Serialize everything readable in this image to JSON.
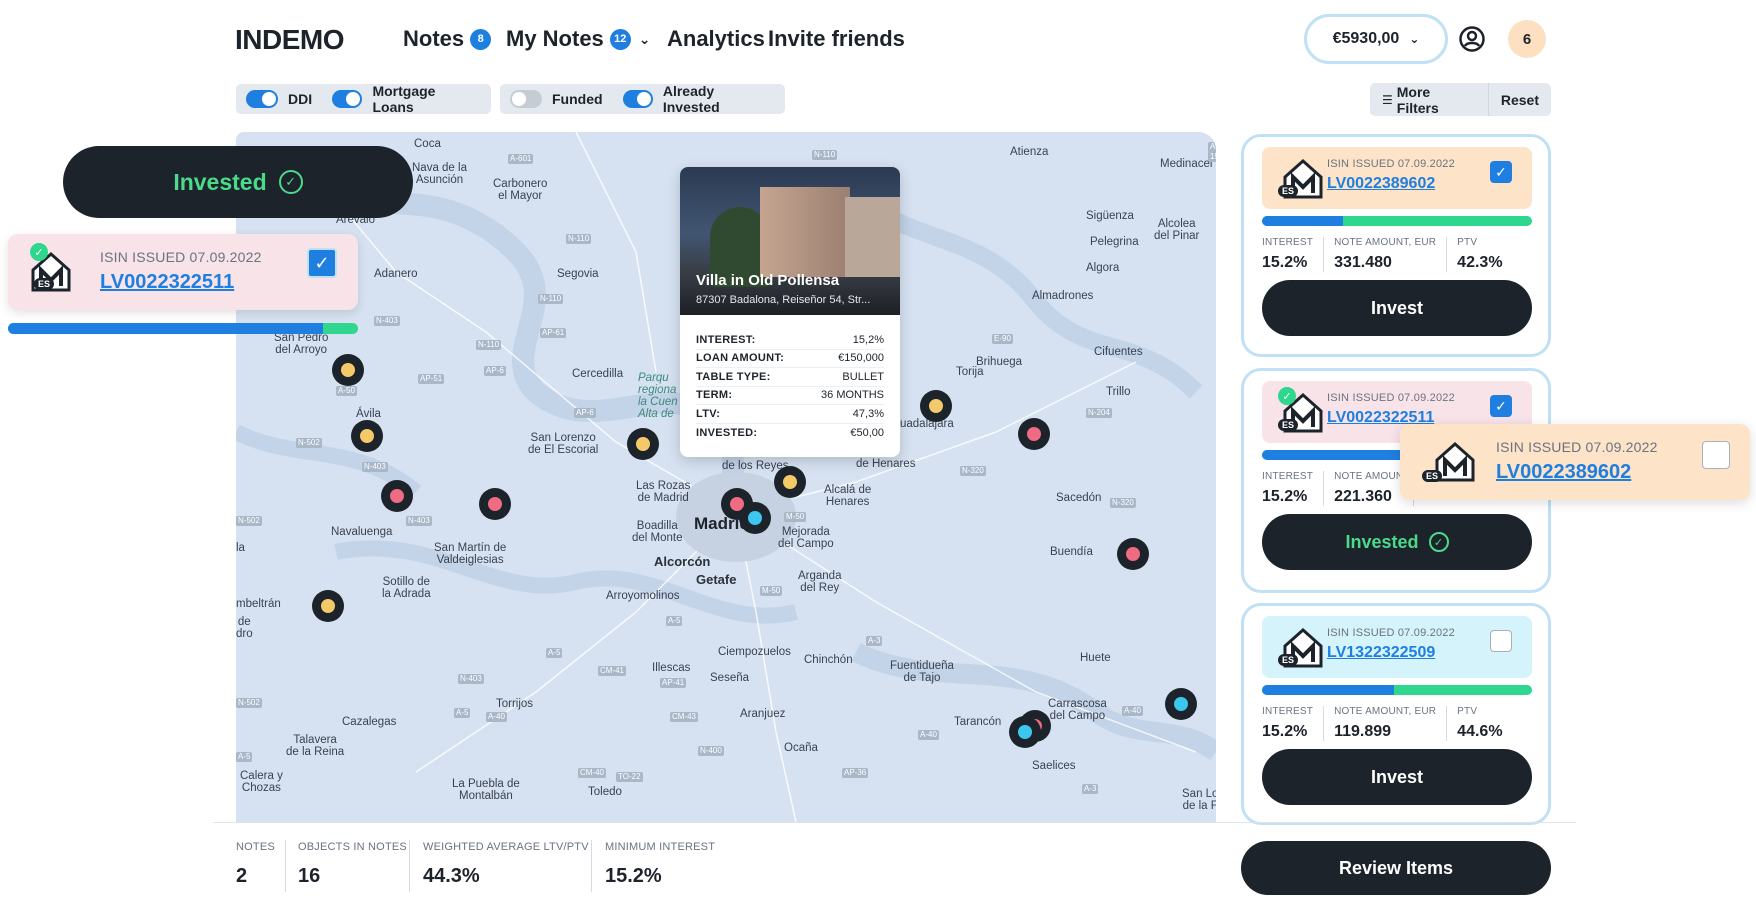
{
  "header": {
    "logo": "INDEMO",
    "nav": [
      {
        "label": "Notes",
        "badge": "8"
      },
      {
        "label": "My Notes",
        "badge": "12"
      },
      {
        "label": "Analytics"
      },
      {
        "label": "Invite friends"
      }
    ],
    "balance": "€5930,00",
    "notifications": "6"
  },
  "filters": {
    "toggles": [
      {
        "label": "DDI",
        "on": true
      },
      {
        "label": "Mortgage Loans",
        "on": true
      },
      {
        "label": "Funded",
        "on": false
      },
      {
        "label": "Already Invested",
        "on": true
      }
    ],
    "more_filters": "More Filters",
    "reset": "Reset"
  },
  "map": {
    "labels": {
      "madrid": "Madrid",
      "getafe": "Getafe",
      "alcorcon": "Alcorcón",
      "coca": "Coca",
      "nava": "Nava de la\nAsunción",
      "carbonero": "Carbonero\nel Mayor",
      "segovia": "Segovia",
      "adanero": "Adanero",
      "arevalo": "Arevalo",
      "sanpedro": "San Pedro\ndel Arroyo",
      "avila": "Ávila",
      "navaluenga": "Navaluenga",
      "cercedilla": "Cercedilla",
      "sanlorenzo": "San Lorenzo\nde El Escorial",
      "lasrozas": "Las Rozas\nde Madrid",
      "boadilla": "Boadilla\ndel Monte",
      "sanmartin": "San Martín de\nValdeiglesias",
      "sotillo": "Sotillo de\nla Adrada",
      "arroyomolinos": "Arroyomolinos",
      "ciempozuelos": "Ciempozuelos",
      "illescas": "Illescas",
      "sesena": "Seseña",
      "chinchon": "Chinchón",
      "fuentiduena": "Fuentidueña\nde Tajo",
      "aranjuez": "Aranjuez",
      "ocana": "Ocaña",
      "tarancon": "Tarancón",
      "carrascosa": "Carrascosa\ndel Campo",
      "saelices": "Saelices",
      "huete": "Huete",
      "buendia": "Buendía",
      "sacedon": "Sacedón",
      "trillo": "Trillo",
      "cifuentes": "Cifuentes",
      "brihuega": "Brihuega",
      "torija": "Torija",
      "almadrones": "Almadrones",
      "algora": "Algora",
      "siguenza": "Sigüenza",
      "pelegrina": "Pelegrina",
      "alcolea": "Alcolea\ndel Pinar",
      "medinaceli": "Medinacel",
      "atienza": "Atienza",
      "guadalajara": "uadalajara",
      "alcala": "Alcalá de\nHenares",
      "mejorada": "Mejorada\ndel Campo",
      "arganda": "Arganda\ndel Rey",
      "cazalegas": "Cazalegas",
      "talavera": "Talavera\nde la Reina",
      "torrijos": "Torrijos",
      "toledo": "Toledo",
      "puebla": "La Puebla de\nMontalbán",
      "calera": "Calera y\nChozas",
      "embeltran": "mbeltrán",
      "dedro": "de\ndro",
      "la": "la",
      "henares": "de Henares",
      "reyes": "de los Reyes",
      "sanlaf": "San Lo\nde la F",
      "parque": "Parqu\nregiona\nla Cuen\nAlta de"
    }
  },
  "tooltip": {
    "title": "Villa in Old Pollensa",
    "address": "87307 Badalona, Reiseñor 54, Str...",
    "rows": [
      {
        "k": "INTEREST:",
        "v": "15,2%"
      },
      {
        "k": "LOAN AMOUNT:",
        "v": "€150,000"
      },
      {
        "k": "TABLE TYPE:",
        "v": "BULLET"
      },
      {
        "k": "TERM:",
        "v": "36 MONTHS"
      },
      {
        "k": "LTV:",
        "v": "47,3%"
      },
      {
        "k": "INVESTED:",
        "v": "€50,00"
      }
    ]
  },
  "float_left": {
    "invested_label": "Invested",
    "isin_label": "ISIN ISSUED 07.09.2022",
    "isin": "LV0022322511",
    "progress": 0.9
  },
  "float_right": {
    "isin_label": "ISIN ISSUED 07.09.2022",
    "isin": "LV0022389602"
  },
  "cards": [
    {
      "isin_label": "ISIN ISSUED 07.09.2022",
      "isin": "LV0022389602",
      "checked": true,
      "head_color": "#fde3c8",
      "progress": 0.3,
      "interest_k": "INTEREST",
      "interest": "15.2%",
      "amount_k": "NOTE AMOUNT, EUR",
      "amount": "331.480",
      "ptv_k": "PTV",
      "ptv": "42.3%",
      "cta": "Invest",
      "invested": false
    },
    {
      "isin_label": "ISIN ISSUED 07.09.2022",
      "isin": "LV0022322511",
      "checked": true,
      "head_color": "#f8e3e8",
      "progress": 0.9,
      "interest_k": "INTEREST",
      "interest": "15.2%",
      "amount_k": "NOTE AMOUN",
      "amount": "221.360",
      "ptv_k": "",
      "ptv": "",
      "cta": "Invested",
      "invested": true
    },
    {
      "isin_label": "ISIN ISSUED 07.09.2022",
      "isin": "LV1322322509",
      "checked": false,
      "head_color": "#d4f3fb",
      "progress": 0.49,
      "interest_k": "INTEREST",
      "interest": "15.2%",
      "amount_k": "NOTE AMOUNT, EUR",
      "amount": "119.899",
      "ptv_k": "PTV",
      "ptv": "44.6%",
      "cta": "Invest",
      "invested": false
    }
  ],
  "footer": {
    "stats": [
      {
        "k": "NOTES",
        "v": "2"
      },
      {
        "k": "OBJECTS IN NOTES",
        "v": "16"
      },
      {
        "k": "WEIGHTED AVERAGE LTV/PTV",
        "v": "44.3%"
      },
      {
        "k": "MINIMUM INTEREST",
        "v": "15.2%"
      }
    ],
    "review": "Review Items"
  },
  "colors": {
    "brand_dark": "#1d232b",
    "accent_blue": "#1f7fe0",
    "accent_green": "#2fd68e",
    "pin_yellow": "#f4c96a",
    "pin_pink": "#ef6b82",
    "pin_cyan": "#3cc8ee"
  }
}
